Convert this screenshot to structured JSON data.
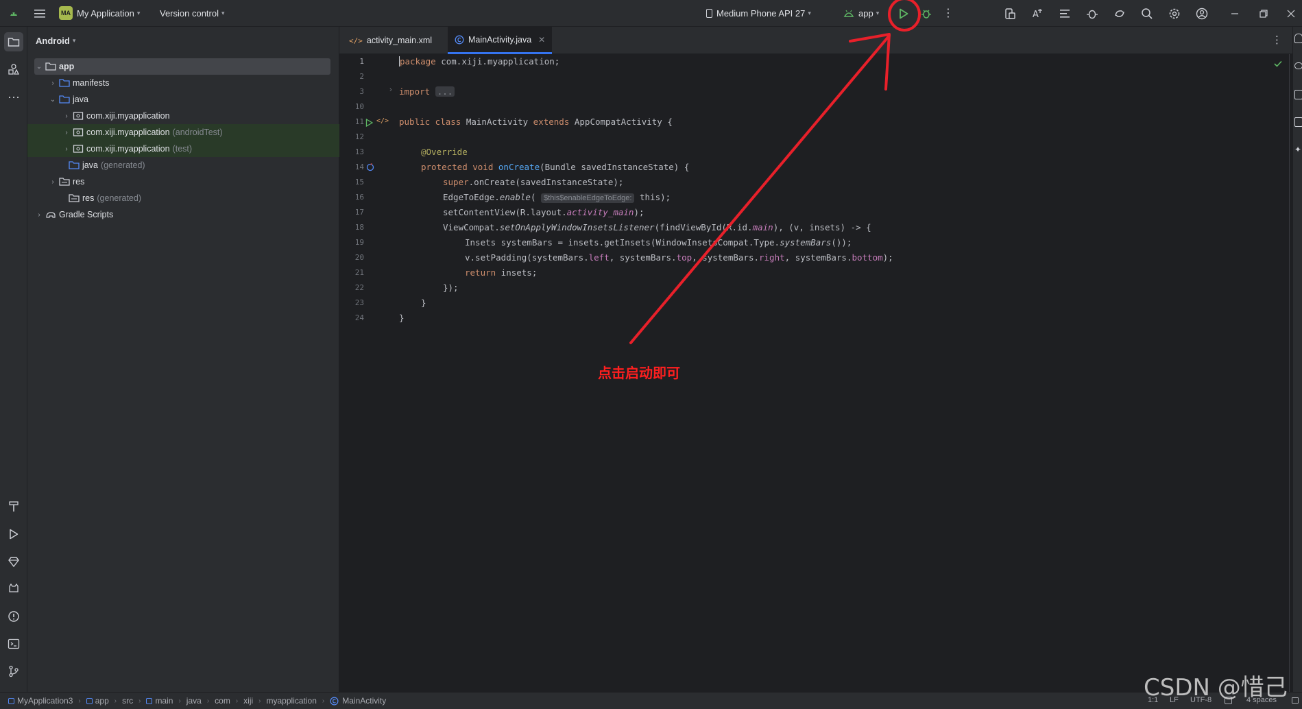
{
  "titlebar": {
    "project_badge": "MA",
    "project_name": "My Application",
    "version_control": "Version control",
    "device": "Medium Phone API 27",
    "run_config": "app"
  },
  "project_panel": {
    "view_label": "Android",
    "tree": [
      {
        "label": "app",
        "hint": ""
      },
      {
        "label": "manifests",
        "hint": ""
      },
      {
        "label": "java",
        "hint": ""
      },
      {
        "label": "com.xiji.myapplication",
        "hint": ""
      },
      {
        "label": "com.xiji.myapplication",
        "hint": "(androidTest)"
      },
      {
        "label": "com.xiji.myapplication",
        "hint": "(test)"
      },
      {
        "label": "java",
        "hint": "(generated)"
      },
      {
        "label": "res",
        "hint": ""
      },
      {
        "label": "res",
        "hint": "(generated)"
      },
      {
        "label": "Gradle Scripts",
        "hint": ""
      }
    ]
  },
  "tabs": [
    {
      "label": "activity_main.xml"
    },
    {
      "label": "MainActivity.java"
    }
  ],
  "editor": {
    "line_numbers": [
      "1",
      "2",
      "3",
      "10",
      "11",
      "12",
      "13",
      "14",
      "15",
      "16",
      "17",
      "18",
      "19",
      "20",
      "21",
      "22",
      "23",
      "24"
    ],
    "code": {
      "l1_kw": "package",
      "l1_rest": " com.xiji.myapplication;",
      "l3_kw": "import",
      "l3_fold": "...",
      "l11_kw": "public class",
      "l11_name": " MainActivity ",
      "l11_kw2": "extends",
      "l11_rest": " AppCompatActivity {",
      "l13_an": "@Override",
      "l14_kw": "protected void",
      "l14_fn": "onCreate",
      "l14_rest": "(Bundle savedInstanceState) {",
      "l15_kw": "super",
      "l15_rest": ".onCreate(savedInstanceState);",
      "l16_a": "EdgeToEdge.",
      "l16_it": "enable",
      "l16_b": "(",
      "l16_inlay": "$this$enableEdgeToEdge:",
      "l16_c": " this);",
      "l17_a": "setContentView(R.layout.",
      "l17_f": "activity_main",
      "l17_b": ");",
      "l18_a": "ViewCompat.",
      "l18_it": "setOnApplyWindowInsetsListener",
      "l18_b": "(findViewById(R.id.",
      "l18_f": "main",
      "l18_c": "), (v, insets) -> {",
      "l19_a": "Insets systemBars = insets.getInsets(WindowInsetsCompat.Type.",
      "l19_it": "systemBars",
      "l19_b": "());",
      "l20_a": "v.setPadding(systemBars.",
      "l20_f1": "left",
      "l20_b": ", systemBars.",
      "l20_f2": "top",
      "l20_c": ", systemBars.",
      "l20_f3": "right",
      "l20_d": ", systemBars.",
      "l20_f4": "bottom",
      "l20_e": ");",
      "l21_kw": "return",
      "l21_rest": " insets;",
      "l22": "});",
      "l23": "}",
      "l24": "}"
    }
  },
  "annotation": {
    "text": "点击启动即可",
    "color": "#ff1f1f"
  },
  "statusbar": {
    "breadcrumbs": [
      "MyApplication3",
      "app",
      "src",
      "main",
      "java",
      "com",
      "xiji",
      "myapplication",
      "MainActivity"
    ],
    "position": "1:1",
    "line_sep": "LF",
    "encoding": "UTF-8",
    "indent": "4 spaces"
  },
  "watermark": "CSDN @惜己",
  "colors": {
    "accent": "#3574f0",
    "run_green": "#5fb865",
    "background": "#1e1f22",
    "panel": "#2b2d30"
  }
}
